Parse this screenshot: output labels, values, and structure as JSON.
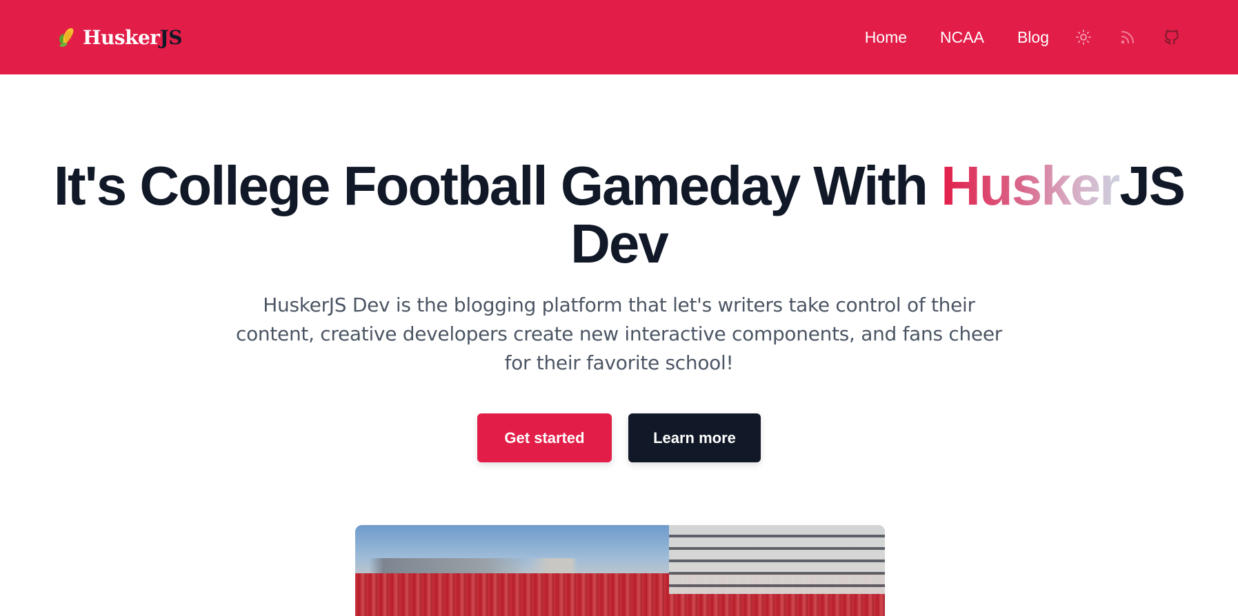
{
  "navbar": {
    "brand_prefix": "Husker",
    "brand_suffix": "JS",
    "links": [
      "Home",
      "NCAA",
      "Blog"
    ],
    "icons": [
      "sun-icon",
      "rss-icon",
      "github-icon"
    ]
  },
  "hero": {
    "title_main": "It's College Football Gameday With ",
    "title_gradient": "Husker",
    "title_js": "JS",
    "title_end": "Dev",
    "subtitle": "HuskerJS Dev is the blogging platform that let's writers take control of their content, creative developers create new interactive components, and fans cheer for their favorite school!",
    "primary_button": "Get started",
    "secondary_button": "Learn more"
  },
  "colors": {
    "brand_red": "#e21d48",
    "dark": "#111827",
    "text_muted": "#4b5563"
  }
}
